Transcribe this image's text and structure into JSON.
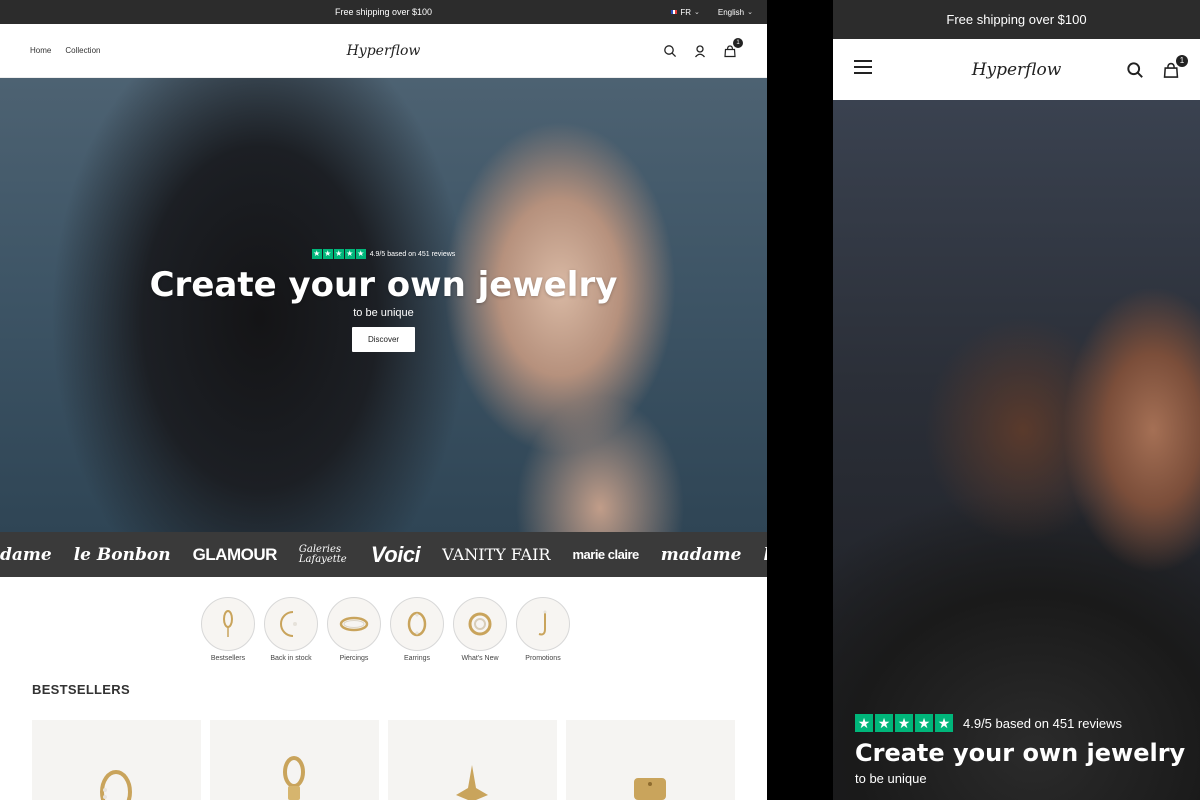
{
  "desktop": {
    "announcement": "Free shipping over $100",
    "country": "FR",
    "language": "English",
    "nav": [
      "Home",
      "Collection"
    ],
    "logo": "Hyperflow",
    "cart_count": "1",
    "hero": {
      "rating_text": "4.9/5 based on 451 reviews",
      "title": "Create your own jewelry",
      "subtitle": "to be unique",
      "cta": "Discover"
    },
    "press": [
      "dame",
      "le Bonbon",
      "GLAMOUR",
      "Galeries Lafayette",
      "Voici",
      "VANITY FAIR",
      "marie claire",
      "madame",
      "le Bonbon"
    ],
    "categories": [
      "Bestsellers",
      "Back in stock",
      "Piercings",
      "Earrings",
      "What's New",
      "Promotions"
    ],
    "bestsellers_title": "BESTSELLERS"
  },
  "mobile": {
    "announcement": "Free shipping over $100",
    "logo": "Hyperflow",
    "cart_count": "1",
    "hero": {
      "rating_text": "4.9/5 based on 451 reviews",
      "title": "Create your own jewelry",
      "subtitle": "to be unique"
    }
  },
  "colors": {
    "trustpilot_green": "#00b67a",
    "announcement_bg": "#2c2c2c",
    "press_bg": "#3a3a3a"
  }
}
